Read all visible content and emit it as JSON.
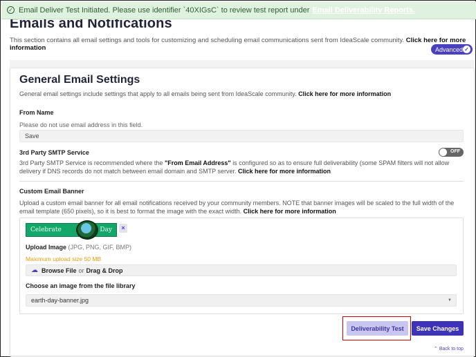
{
  "toast": {
    "message": "Email Deliver Test Initiated. Please use identifier `40XIGsC` to review test report under",
    "link": "Email Deliverability Reports."
  },
  "page": {
    "title": "Emails and Notifications",
    "intro": "This section contains all email settings and tools for customizing and scheduling email communications sent from IdeaScale community.",
    "intro_link": "Click here for more information",
    "advanced_label": "Advanced"
  },
  "general": {
    "title": "General Email Settings",
    "description": "General email settings include settings that apply to all emails being sent from IdeaScale community.",
    "link": "Click here for more information"
  },
  "from_name": {
    "label": "From Name",
    "help": "Please do not use email address in this field.",
    "value": "Save"
  },
  "smtp": {
    "label": "3rd Party SMTP Service",
    "toggle_text": "OFF",
    "desc_part1": "3rd Party SMTP Service is recommended where the",
    "desc_bold": "\"From Email Address\"",
    "desc_part2": "is configured so as to ensure full deliverability (some SPAM filters will not allow delivery if DNS records do not match between email domain and SMTP server.",
    "link": "Click here for more information"
  },
  "banner": {
    "label": "Custom Email Banner",
    "desc": "Upload a custom email banner for all email notifications received by your community members. NOTE that banner images will be scaled to the full width of the email template (650 pixels), so it is best to format the image with the exact width.",
    "link": "Click here for more information",
    "image_left": "Celebrate",
    "image_right": "Day",
    "remove": "×",
    "upload_label": "Upload Image",
    "upload_types": "(JPG, PNG, GIF, BMP)",
    "max_size": "Maximum upload size 50 MB",
    "browse": "Browse File",
    "or": "or",
    "drag": "Drag & Drop",
    "library_label": "Choose an image from the file library",
    "library_value": "earth-day-banner.jpg"
  },
  "actions": {
    "deliverability": "Deliverability Test",
    "save": "Save Changes",
    "back_to_top": "Back to top"
  },
  "colors": {
    "accent": "#3d33b8",
    "toast_bg": "#dff2df",
    "warning": "#e89b0b",
    "highlight": "#d40000"
  }
}
